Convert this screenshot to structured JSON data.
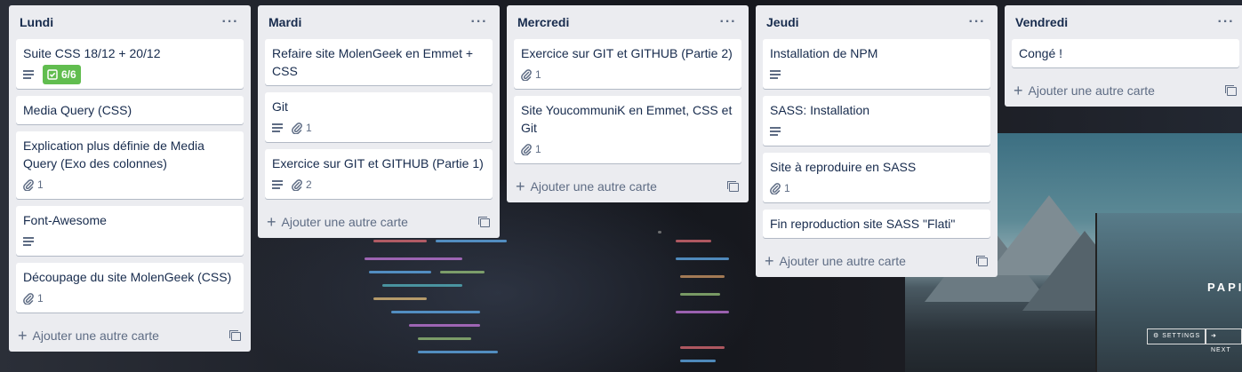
{
  "board": {
    "add_card_label": "Ajouter une autre carte",
    "lists": [
      {
        "title": "Lundi",
        "cards": [
          {
            "title": "Suite CSS 18/12 + 20/12",
            "has_description": true,
            "checklist": "6/6"
          },
          {
            "title": "Media Query (CSS)"
          },
          {
            "title": "Explication plus définie de Media Query (Exo des colonnes)",
            "attachments": "1"
          },
          {
            "title": "Font-Awesome",
            "has_description": true
          },
          {
            "title": "Découpage du site MolenGeek (CSS)",
            "attachments": "1"
          }
        ]
      },
      {
        "title": "Mardi",
        "cards": [
          {
            "title": "Refaire site MolenGeek en Emmet + CSS"
          },
          {
            "title": "Git",
            "has_description": true,
            "attachments": "1"
          },
          {
            "title": "Exercice sur GIT et GITHUB (Partie 1)",
            "has_description": true,
            "attachments": "2"
          }
        ]
      },
      {
        "title": "Mercredi",
        "cards": [
          {
            "title": "Exercice sur GIT et GITHUB (Partie 2)",
            "attachments": "1"
          },
          {
            "title": "Site YoucommuniK en Emmet, CSS et Git",
            "attachments": "1"
          }
        ]
      },
      {
        "title": "Jeudi",
        "cards": [
          {
            "title": "Installation de NPM",
            "has_description": true
          },
          {
            "title": "SASS: Installation",
            "has_description": true
          },
          {
            "title": "Site à reproduire en SASS",
            "attachments": "1"
          },
          {
            "title": "Fin reproduction site SASS \"Flati\""
          }
        ]
      },
      {
        "title": "Vendredi",
        "cards": [
          {
            "title": "Congé !"
          }
        ]
      }
    ]
  },
  "background": {
    "panel_word": "PAPI",
    "settings_label": "⚙ SETTINGS",
    "next_label": "➜ NEXT"
  },
  "colors": {
    "list_bg": "#ebecf0",
    "card_bg": "#ffffff",
    "checklist_complete": "#61bd4f",
    "text": "#172b4d",
    "muted": "#5e6c84"
  }
}
